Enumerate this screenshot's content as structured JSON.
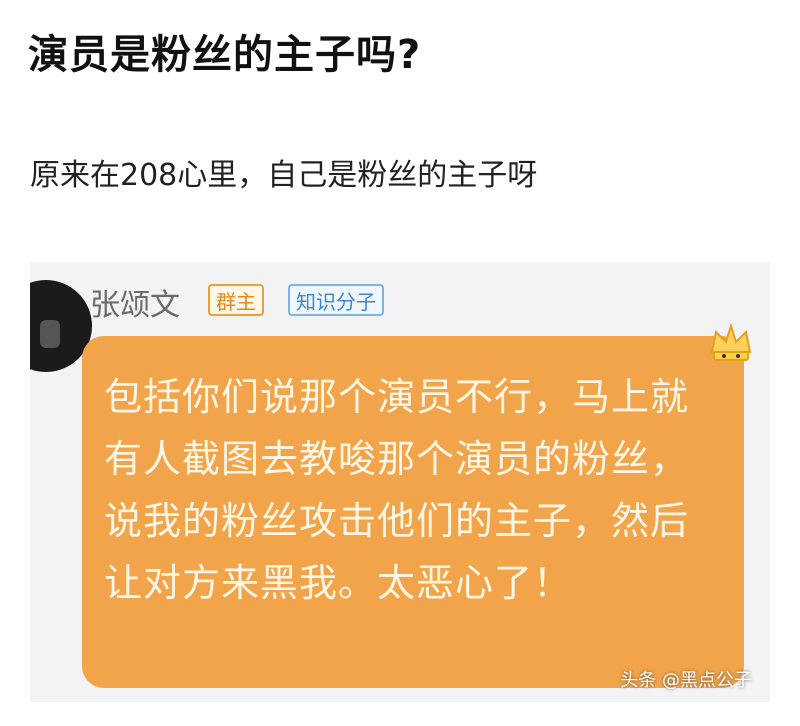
{
  "post": {
    "title": "演员是粉丝的主子吗?",
    "subtitle": "原来在208心里，自己是粉丝的主子呀"
  },
  "chat": {
    "sender_name": "张颂文",
    "badges": [
      "群主",
      "知识分子"
    ],
    "message": "包括你们说那个演员不行，马上就有人截图去教唆那个演员的粉丝，说我的粉丝攻击他们的主子，然后让对方来黑我。太恶心了！",
    "bubble_color": "#f2a44a",
    "crown_icon": "crown-icon"
  },
  "watermark": "头条 @黑点公子"
}
